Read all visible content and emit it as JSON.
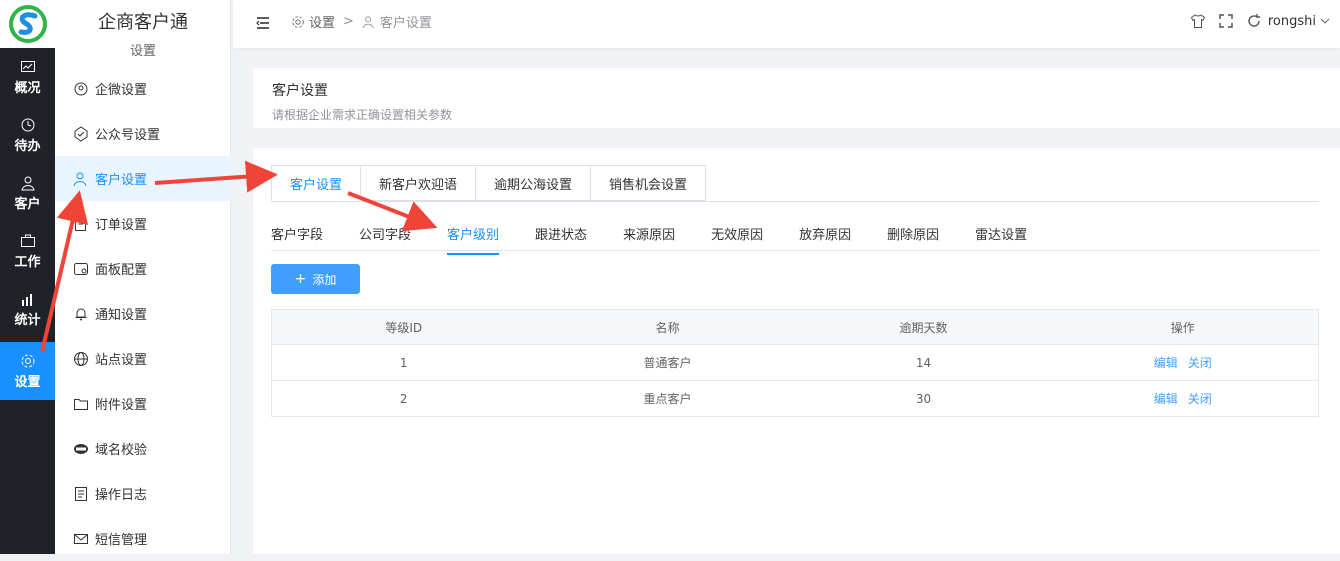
{
  "rail": {
    "items": [
      {
        "label": "概况",
        "icon": "chart-icon"
      },
      {
        "label": "待办",
        "icon": "clock-icon"
      },
      {
        "label": "客户",
        "icon": "user-icon"
      },
      {
        "label": "工作",
        "icon": "briefcase-icon"
      },
      {
        "label": "统计",
        "icon": "stats-icon"
      },
      {
        "label": "设置",
        "icon": "gear-icon"
      }
    ]
  },
  "sidebar": {
    "brand": "企商客户通",
    "subtitle": "设置",
    "items": [
      {
        "label": "企微设置"
      },
      {
        "label": "公众号设置"
      },
      {
        "label": "客户设置"
      },
      {
        "label": "订单设置"
      },
      {
        "label": "面板配置"
      },
      {
        "label": "通知设置"
      },
      {
        "label": "站点设置"
      },
      {
        "label": "附件设置"
      },
      {
        "label": "域名校验"
      },
      {
        "label": "操作日志"
      },
      {
        "label": "短信管理"
      }
    ]
  },
  "header": {
    "crumb1": "设置",
    "separator": ">",
    "crumb2": "客户设置",
    "user": "rongshi"
  },
  "page": {
    "title": "客户设置",
    "description": "请根据企业需求正确设置相关参数"
  },
  "tabs": [
    "客户设置",
    "新客户欢迎语",
    "逾期公海设置",
    "销售机会设置"
  ],
  "subtabs": [
    "客户字段",
    "公司字段",
    "客户级别",
    "跟进状态",
    "来源原因",
    "无效原因",
    "放弃原因",
    "删除原因",
    "雷达设置"
  ],
  "add_button": "添加",
  "table": {
    "headers": [
      "等级ID",
      "名称",
      "逾期天数",
      "操作"
    ],
    "rows": [
      {
        "id": "1",
        "name": "普通客户",
        "days": "14"
      },
      {
        "id": "2",
        "name": "重点客户",
        "days": "30"
      }
    ],
    "edit_label": "编辑",
    "close_label": "关闭"
  },
  "colors": {
    "accent": "#1890ff",
    "annotation": "#f04438",
    "rail_bg": "#1f2329"
  }
}
